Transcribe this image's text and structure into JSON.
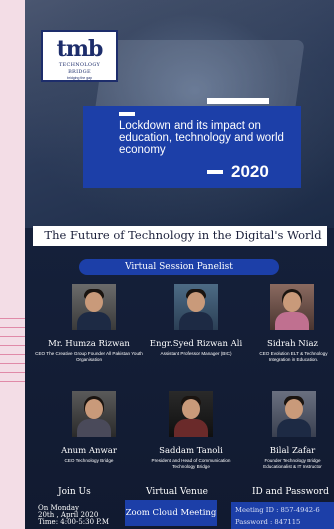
{
  "logo": {
    "mark": "tmb",
    "name": "TECHNOLOGY BRIDGE",
    "tagline": "bridging the gap"
  },
  "event": {
    "title": "Lockdown and its impact on education, technology and world economy",
    "year": "2020",
    "subtitle": "The Future of  Technology in the  Digital's World",
    "panel_heading": "Virtual Session Panelist"
  },
  "panelists": [
    {
      "name": "Mr. Humza Rizwan",
      "role": "CEO The Creative Group Founder All Pakistan Youth Organisation"
    },
    {
      "name": "Engr.Syed Rizwan Ali",
      "role": "Assistant Professor Manager (BIC)"
    },
    {
      "name": "Sidrah Niaz",
      "role": "CEO Evolution ELT & Technology Integration in Education."
    },
    {
      "name": "Anum Anwar",
      "role": "CEO Technology Bridge"
    },
    {
      "name": "Saddam Tanoli",
      "role": "President and Head of Communication Technology Bridge"
    },
    {
      "name": "Bilal Zafar",
      "role": "Founder Technology Bridge Educationalist & IT Instructor"
    }
  ],
  "footer": {
    "join_heading": "Join Us",
    "date_line1": "On Monday",
    "date_line2": "20th , April  2020",
    "time": "Time: 4:00-5:30 P.M",
    "venue_heading": "Virtual Venue",
    "venue": "Zoom Cloud Meeting",
    "id_heading": "ID and Password",
    "meeting_id": "Meeting ID :  857-4942-6",
    "password": "Password  :   847115"
  },
  "colors": {
    "accent": "#1c3fa8",
    "background": "#15203a",
    "page": "#f3dde6"
  }
}
